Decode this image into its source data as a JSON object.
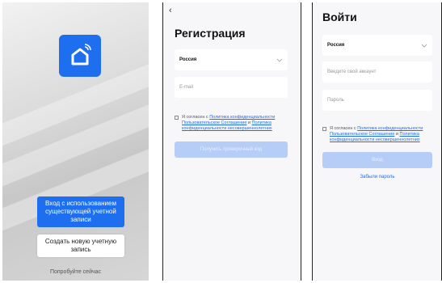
{
  "splash": {
    "login_existing_button": "Вход с использованием существующей учетной записи",
    "create_account_button": "Создать новую учетную запись",
    "try_now_link": "Попробуйте сейчас",
    "app_icon": "home-icon"
  },
  "register": {
    "back_icon": "back-arrow-icon",
    "title": "Регистрация",
    "country_value": "Россия",
    "email_placeholder": "E-mail",
    "consent_prefix": "Я согласен с ",
    "privacy_link": "Политика конфиденциальности",
    "terms_link": "Пользовательское Соглашение",
    "and_text": " и ",
    "minors_link": "конфиденциальности несовершеннолетних",
    "minors_prefix": "Политика ",
    "get_code_button": "Получить проверочный код"
  },
  "login": {
    "title": "Войти",
    "country_value": "Россия",
    "account_placeholder": "Введите свой аккаунт",
    "password_placeholder": "Пароль",
    "consent_prefix": "Я согласен с ",
    "privacy_link": "Политика конфиденциальности",
    "terms_link": "Пользовательское Соглашение",
    "and_text": " и ",
    "minors_prefix": "Политика ",
    "minors_link": "конфиденциальности несовершеннолетних",
    "login_button": "Вход",
    "forgot_link": "Забыли пароль"
  },
  "colors": {
    "accent": "#1e6ff0",
    "disabled": "#b5cdf7"
  }
}
